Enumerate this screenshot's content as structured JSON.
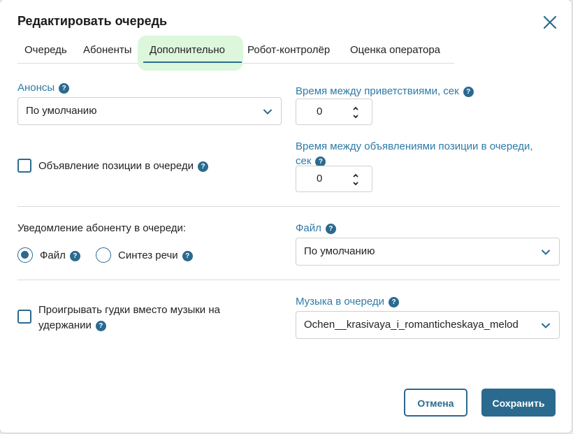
{
  "dialog": {
    "title": "Редактировать очередь",
    "close_icon": "close-icon"
  },
  "tabs": [
    {
      "label": "Очередь"
    },
    {
      "label": "Абоненты"
    },
    {
      "label": "Дополнительно",
      "active": true
    },
    {
      "label": "Робот-контролёр"
    },
    {
      "label": "Оценка оператора"
    }
  ],
  "announcements": {
    "label": "Анонсы",
    "value": "По умолчанию"
  },
  "greeting_interval": {
    "label": "Время между приветствиями, сек",
    "value": "0"
  },
  "position_announce": {
    "label": "Объявление позиции в очереди",
    "checked": false
  },
  "position_interval": {
    "label_line1": "Время между объявлениями позиции в очереди,",
    "label_line2": "сек",
    "value": "0"
  },
  "notify": {
    "label": "Уведомление абоненту в очереди:",
    "option_file": "Файл",
    "option_tts": "Синтез речи",
    "selected": "Файл"
  },
  "file": {
    "label": "Файл",
    "value": "По умолчанию"
  },
  "beeps": {
    "label_line1": "Проигрывать гудки вместо музыки на",
    "label_line2": "удержании",
    "checked": false
  },
  "music": {
    "label": "Музыка в очереди",
    "value": "Ochen__krasivaya_i_romanticheskaya_melod"
  },
  "help_glyph": "?",
  "buttons": {
    "cancel": "Отмена",
    "save": "Сохранить"
  },
  "colors": {
    "accent": "#2b6a8f",
    "label_blue": "#2e7ba6",
    "active_tab_bg": "#dcf7dc"
  }
}
